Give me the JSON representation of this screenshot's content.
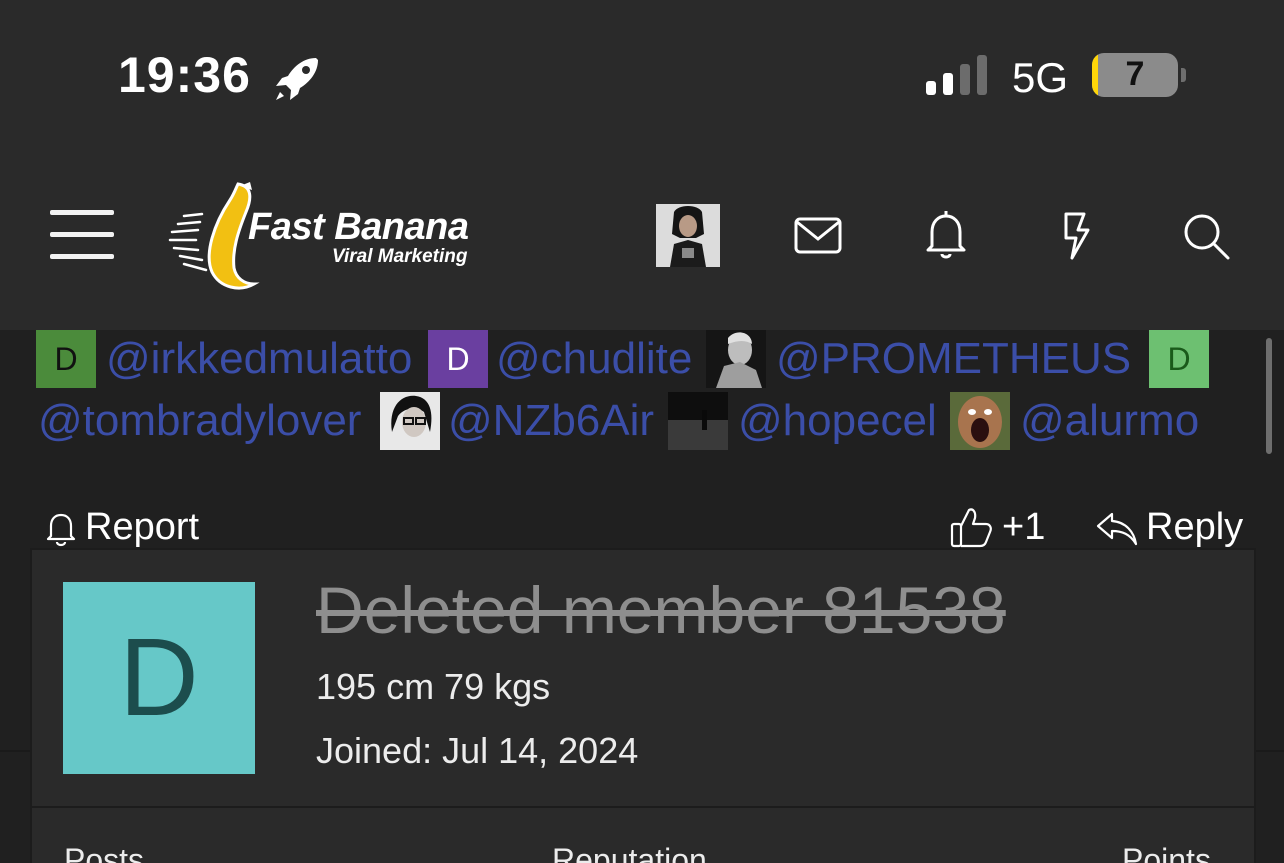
{
  "status_bar": {
    "time": "19:36",
    "network": "5G",
    "battery_level": "7",
    "icons": [
      "rocket-icon",
      "signal-bars-icon",
      "battery-icon"
    ]
  },
  "nav": {
    "logo_title": "Fast Banana",
    "logo_subtitle": "Viral Marketing",
    "icons": [
      "hamburger-menu-icon",
      "user-avatar",
      "mail-icon",
      "bell-icon",
      "lightning-icon",
      "search-icon"
    ]
  },
  "mentions": [
    {
      "avatar_letter": "D",
      "avatar_color": "#4b8b3b",
      "handle": "@irkkedmulatto"
    },
    {
      "avatar_letter": "D",
      "avatar_color": "#6a3fa0",
      "handle": "@chudlite"
    },
    {
      "avatar_letter": "",
      "avatar_color": "#1a1a1a",
      "handle": "@PROMETHEUS"
    },
    {
      "avatar_letter": "D",
      "avatar_color": "#6dc071",
      "handle": "@tombradylover"
    },
    {
      "avatar_letter": "",
      "avatar_color": "#cfcfcf",
      "handle": "@NZb6Air"
    },
    {
      "avatar_letter": "",
      "avatar_color": "#141414",
      "handle": "@hopecel"
    },
    {
      "avatar_letter": "",
      "avatar_color": "#7a5a3a",
      "handle": "@alurmo"
    }
  ],
  "actions": {
    "report_label": "Report",
    "like_count": "+1",
    "reply_label": "Reply"
  },
  "member_card": {
    "avatar_letter": "D",
    "avatar_color": "#66c8c8",
    "name": "Deleted member 81538",
    "stats": "195 cm 79 kgs",
    "joined": "Joined: Jul 14, 2024",
    "stat_headers": [
      "Posts",
      "Reputation",
      "Points"
    ]
  },
  "colors": {
    "background": "#202020",
    "header": "#2a2a2a",
    "mention_link": "#3b4ea8",
    "banana_yellow": "#f2c012"
  }
}
